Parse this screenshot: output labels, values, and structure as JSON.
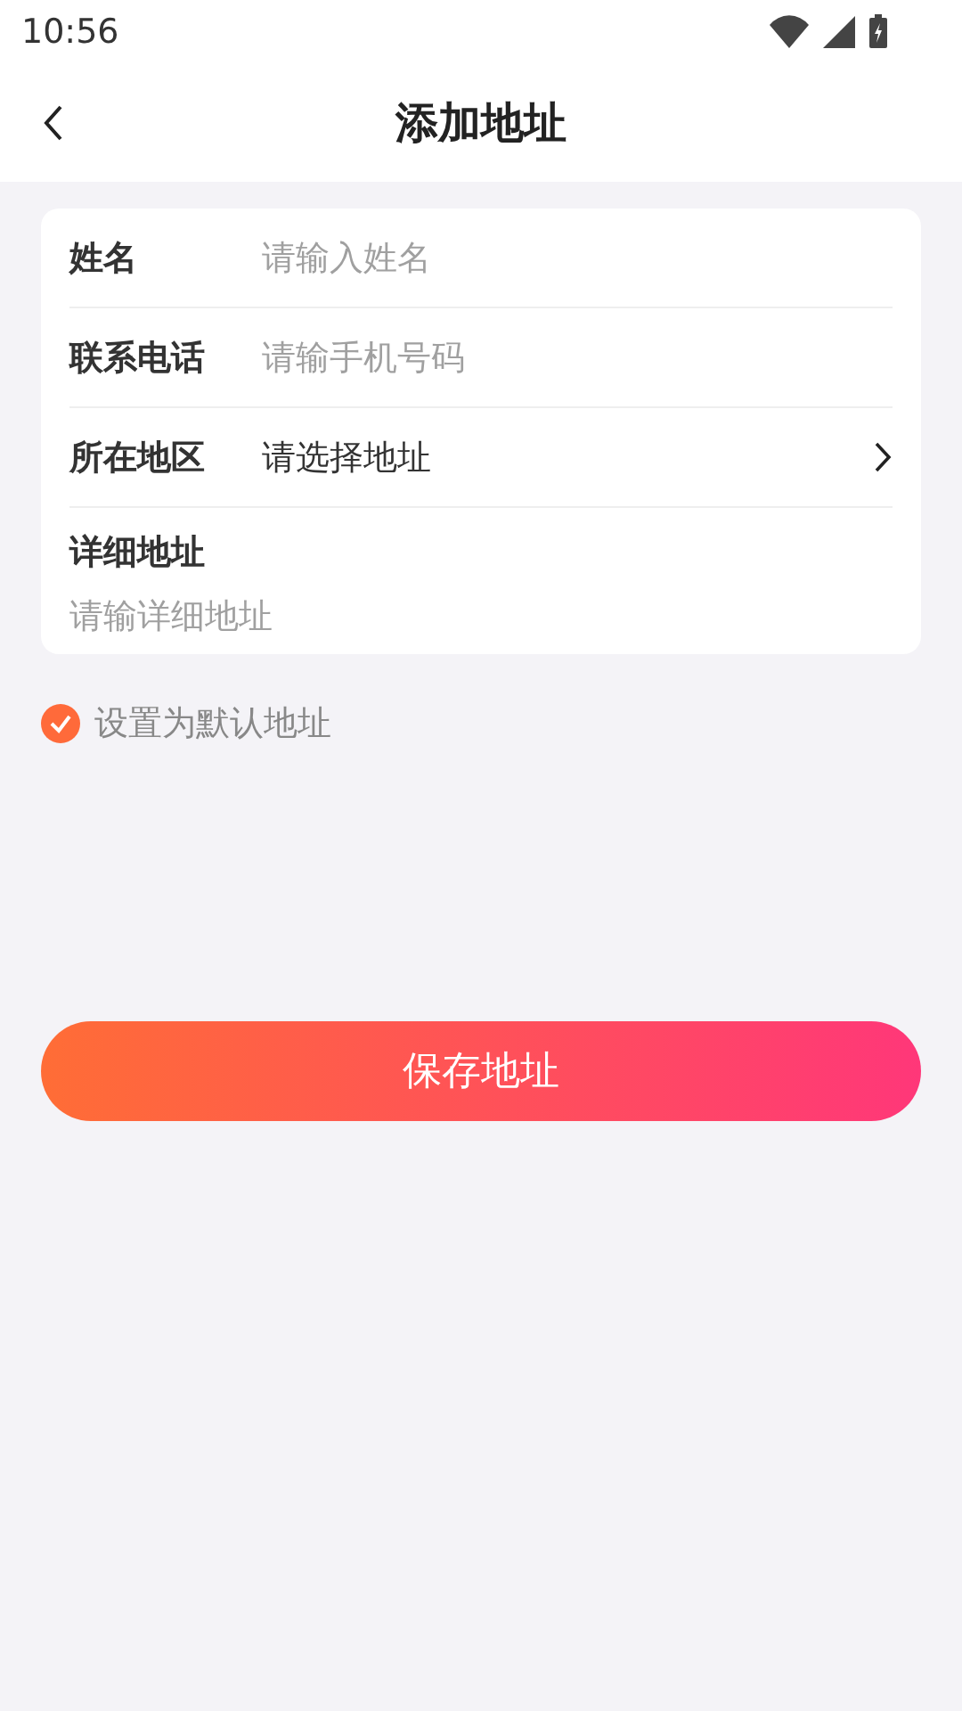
{
  "status_bar": {
    "time": "10:56"
  },
  "header": {
    "title": "添加地址"
  },
  "form": {
    "fields": [
      {
        "kind": "input",
        "label": "姓名",
        "placeholder": "请输入姓名"
      },
      {
        "kind": "input",
        "label": "联系电话",
        "placeholder": "请输手机号码"
      },
      {
        "kind": "select",
        "label": "所在地区",
        "value": "请选择地址"
      },
      {
        "kind": "textarea",
        "label": "详细地址",
        "placeholder": "请输详细地址"
      }
    ]
  },
  "default_checkbox": {
    "label": "设置为默认地址",
    "checked": true
  },
  "save_button": {
    "label": "保存地址"
  }
}
